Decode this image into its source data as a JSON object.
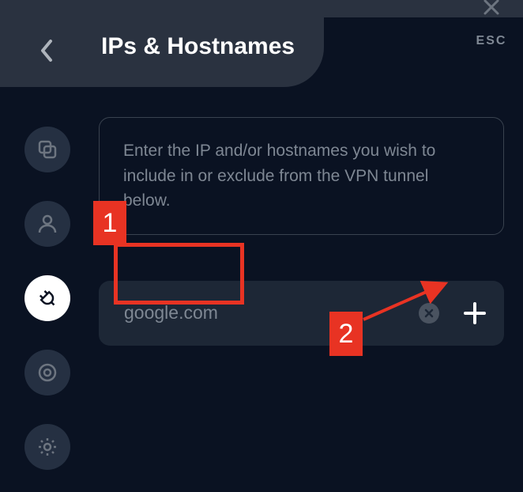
{
  "header": {
    "title": "IPs & Hostnames",
    "esc_label": "ESC"
  },
  "info": {
    "text": "Enter the IP and/or hostnames you wish to include in or exclude from the VPN tunnel below."
  },
  "input": {
    "value": "google.com",
    "placeholder": ""
  },
  "annotations": {
    "label1": "1",
    "label2": "2"
  }
}
